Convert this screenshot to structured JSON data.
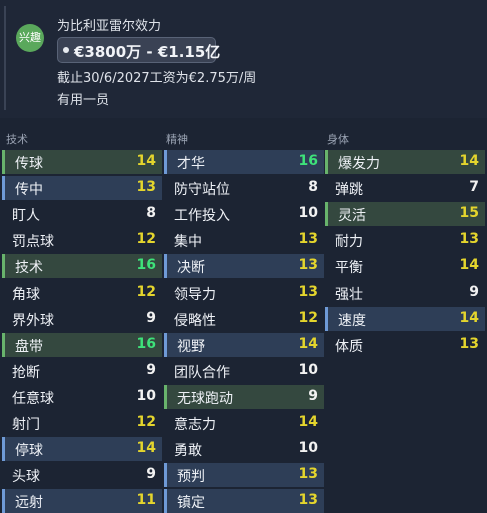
{
  "colors": {
    "value_white": "#f2f2f2",
    "value_yellow": "#e4d52d",
    "value_green": "#3ee27a",
    "row_green_bg": "#34483f",
    "row_green_border": "#68b36c",
    "row_blue_bg": "#2e3e57",
    "row_blue_border": "#6f9ad6"
  },
  "header": {
    "badge_label": "兴趣",
    "club_text": "为比利亚雷尔效力",
    "wage_range": "€3800万 - €1.15亿",
    "contract_text": "截止30/6/2027工资为€2.75万/周",
    "role_text": "有用一员"
  },
  "columns": [
    {
      "title": "技术",
      "attributes": [
        {
          "name": "传球",
          "value": "14",
          "tone": "yellow",
          "highlight": "green"
        },
        {
          "name": "传中",
          "value": "13",
          "tone": "yellow",
          "highlight": "blue"
        },
        {
          "name": "盯人",
          "value": "8",
          "tone": "white",
          "highlight": ""
        },
        {
          "name": "罚点球",
          "value": "12",
          "tone": "yellow",
          "highlight": ""
        },
        {
          "name": "技术",
          "value": "16",
          "tone": "green",
          "highlight": "green"
        },
        {
          "name": "角球",
          "value": "12",
          "tone": "yellow",
          "highlight": ""
        },
        {
          "name": "界外球",
          "value": "9",
          "tone": "white",
          "highlight": ""
        },
        {
          "name": "盘带",
          "value": "16",
          "tone": "green",
          "highlight": "green"
        },
        {
          "name": "抢断",
          "value": "9",
          "tone": "white",
          "highlight": ""
        },
        {
          "name": "任意球",
          "value": "10",
          "tone": "white",
          "highlight": ""
        },
        {
          "name": "射门",
          "value": "12",
          "tone": "yellow",
          "highlight": ""
        },
        {
          "name": "停球",
          "value": "14",
          "tone": "yellow",
          "highlight": "blue"
        },
        {
          "name": "头球",
          "value": "9",
          "tone": "white",
          "highlight": ""
        },
        {
          "name": "远射",
          "value": "11",
          "tone": "yellow",
          "highlight": "blue"
        }
      ]
    },
    {
      "title": "精神",
      "attributes": [
        {
          "name": "才华",
          "value": "16",
          "tone": "green",
          "highlight": "blue"
        },
        {
          "name": "防守站位",
          "value": "8",
          "tone": "white",
          "highlight": ""
        },
        {
          "name": "工作投入",
          "value": "10",
          "tone": "white",
          "highlight": ""
        },
        {
          "name": "集中",
          "value": "13",
          "tone": "yellow",
          "highlight": ""
        },
        {
          "name": "决断",
          "value": "13",
          "tone": "yellow",
          "highlight": "blue"
        },
        {
          "name": "领导力",
          "value": "13",
          "tone": "yellow",
          "highlight": ""
        },
        {
          "name": "侵略性",
          "value": "12",
          "tone": "yellow",
          "highlight": ""
        },
        {
          "name": "视野",
          "value": "14",
          "tone": "yellow",
          "highlight": "blue"
        },
        {
          "name": "团队合作",
          "value": "10",
          "tone": "white",
          "highlight": ""
        },
        {
          "name": "无球跑动",
          "value": "9",
          "tone": "white",
          "highlight": "green"
        },
        {
          "name": "意志力",
          "value": "14",
          "tone": "yellow",
          "highlight": ""
        },
        {
          "name": "勇敢",
          "value": "10",
          "tone": "white",
          "highlight": ""
        },
        {
          "name": "预判",
          "value": "13",
          "tone": "yellow",
          "highlight": "blue"
        },
        {
          "name": "镇定",
          "value": "13",
          "tone": "yellow",
          "highlight": "blue"
        }
      ]
    },
    {
      "title": "身体",
      "attributes": [
        {
          "name": "爆发力",
          "value": "14",
          "tone": "yellow",
          "highlight": "green"
        },
        {
          "name": "弹跳",
          "value": "7",
          "tone": "white",
          "highlight": ""
        },
        {
          "name": "灵活",
          "value": "15",
          "tone": "yellow",
          "highlight": "green"
        },
        {
          "name": "耐力",
          "value": "13",
          "tone": "yellow",
          "highlight": ""
        },
        {
          "name": "平衡",
          "value": "14",
          "tone": "yellow",
          "highlight": ""
        },
        {
          "name": "强壮",
          "value": "9",
          "tone": "white",
          "highlight": ""
        },
        {
          "name": "速度",
          "value": "14",
          "tone": "yellow",
          "highlight": "blue"
        },
        {
          "name": "体质",
          "value": "13",
          "tone": "yellow",
          "highlight": ""
        }
      ]
    }
  ]
}
